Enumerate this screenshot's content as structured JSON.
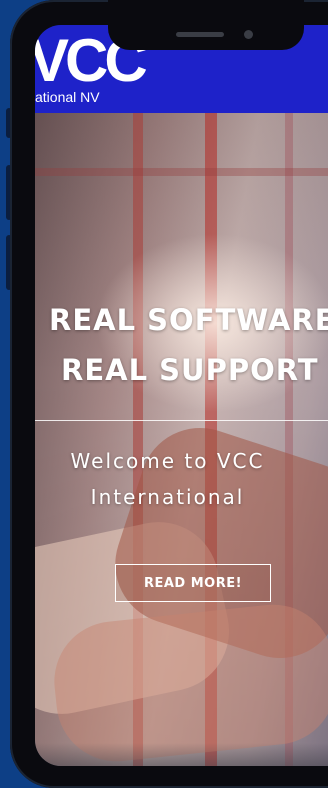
{
  "header": {
    "logo_mark": "VCC",
    "logo_text": "ational NV"
  },
  "hero": {
    "headline_line1": "REAL SOFTWARE",
    "headline_line2": "REAL SUPPORT",
    "welcome_line1": "Welcome to VCC",
    "welcome_line2": "International",
    "read_more_label": "READ MORE!"
  },
  "colors": {
    "page_background": "#0d3f86",
    "header_background": "#1e22c9",
    "text": "#ffffff"
  },
  "icons": [
    "speaker-grille-icon",
    "front-camera-icon"
  ]
}
